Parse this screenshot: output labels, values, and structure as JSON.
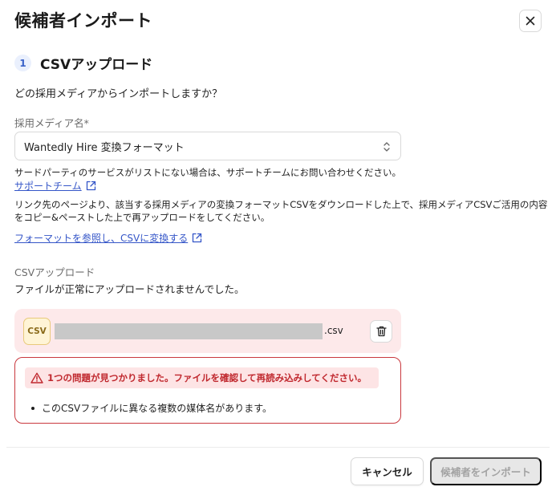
{
  "dialog": {
    "title": "候補者インポート"
  },
  "step": {
    "number": "1",
    "title": "CSVアップロード"
  },
  "form": {
    "question": "どの採用メディアからインポートしますか？",
    "media_label": "採用メディア名*",
    "media_selected": "Wantedly Hire 変換フォーマット",
    "help_text": "サードパーティのサービスがリストにない場合は、サポートチームにお問い合わせください。",
    "support_link": "サポートチーム",
    "description": "リンク先のページより、該当する採用メディアの変換フォーマットCSVをダウンロードした上で、採用メディアCSVご活用の内容をコピー&ペーストした上で再アップロードをしてください。",
    "format_link": "フォーマットを参照し、CSVに変換する"
  },
  "upload": {
    "label": "CSVアップロード",
    "status_message": "ファイルが正常にアップロードされませんでした。",
    "file_badge": "CSV",
    "file_extension": ".csv"
  },
  "error": {
    "heading": "1つの問題が見つかりました。ファイルを確認して再読み込みしてください。",
    "items": [
      "このCSVファイルに異なる複数の媒体名があります。"
    ]
  },
  "footer": {
    "cancel_label": "キャンセル",
    "import_label": "候補者をインポート"
  },
  "colors": {
    "link": "#3556c8",
    "error": "#c0282e",
    "error_bg": "#fde4e5",
    "file_card_bg": "#fde9ea",
    "step_badge_bg": "#eaf0fd"
  }
}
